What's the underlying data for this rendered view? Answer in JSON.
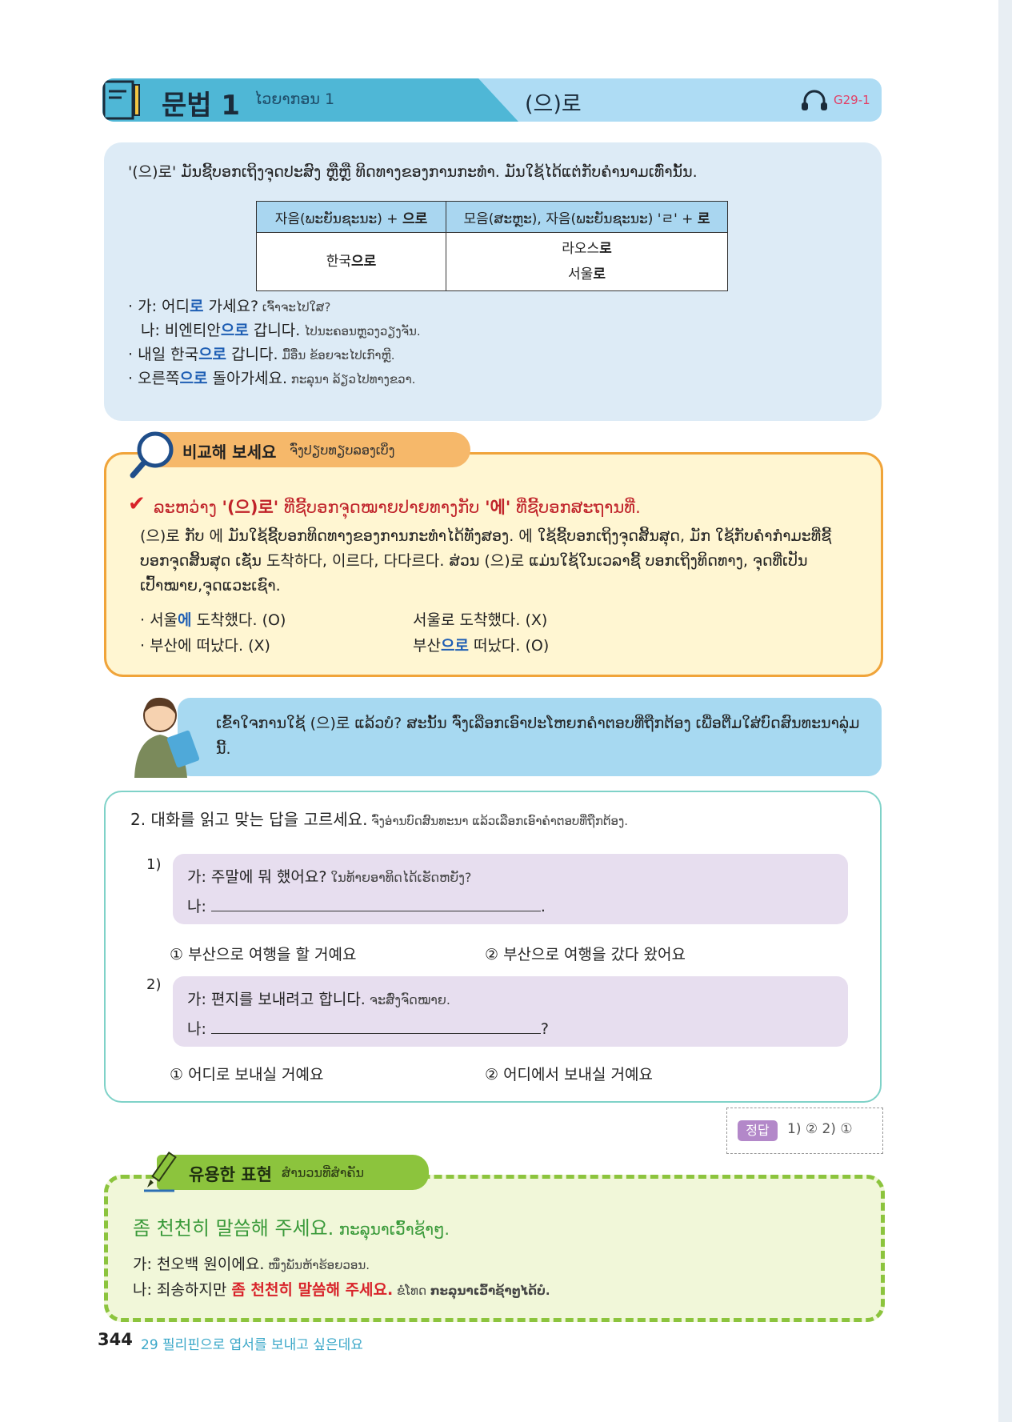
{
  "header": {
    "title": "문법 1",
    "lao": "ໄວຍາກອນ 1",
    "pattern": "(으)로",
    "audio_code": "G29-1"
  },
  "grammar": {
    "intro": "'(으)로' ມັນຊີ້ບອກເຖິງຈຸດປະສົງ ຫຼືຫຼື ທິດທາງຂອງການກະທຳ. ມັນໃຊ້ໄດ້ແຕ່ກັບຄຳນາມເທົ່ານັ້ນ.",
    "table": {
      "head_a": "자음(ພະຍັນຊະນະ) + ",
      "head_a_bold": "으로",
      "head_b": "모음(ສະຫຼະ), 자음(ພະຍັນຊະນະ) 'ㄹ' + ",
      "head_b_bold": "로",
      "cell_a_stem": "한국",
      "cell_a_ending": "으로",
      "cell_b1_stem": "라오스",
      "cell_b1_ending": "로",
      "cell_b2_stem": "서울",
      "cell_b2_ending": "로"
    },
    "examples": [
      {
        "bullet": "·",
        "pre": "가: 어디",
        "hl": "로",
        "post": " 가세요?",
        "lao": " ເຈົ້າຈະໄປໃສ?"
      },
      {
        "bullet": "",
        "pre": "나: 비엔티안",
        "hl": "으로",
        "post": " 갑니다.",
        "lao": " ໄປນະຄອນຫຼວງວຽງຈັນ."
      },
      {
        "bullet": "·",
        "pre": "내일 한국",
        "hl": "으로",
        "post": " 갑니다.",
        "lao": " ມື້ອື່ນ ຂ້ອຍຈະໄປເກົາຫຼີ."
      },
      {
        "bullet": "·",
        "pre": "오른쪽",
        "hl": "으로",
        "post": " 돌아가세요.",
        "lao": " ກະລຸນາ ລ້ຽວໄປທາງຂວາ."
      }
    ]
  },
  "compare": {
    "title": "비교해 보세요",
    "lao": "ຈົ່ງປຽບທຽບລອງເບິ່ງ",
    "heading_1": "ລະຫວ່າງ ",
    "heading_bold_1": "'(으)로'",
    "heading_2": " ທີ່ຊີ້ບອກຈຸດໝາຍປາຍທາງກັບ ",
    "heading_bold_2": "'에'",
    "heading_3": " ທີ່ຊີ້ບອກສະຖານທີ່.",
    "body": "(으)로 ກັບ 에 ມັນໃຊ້ຊີ້ບອກທິດທາງຂອງການກະທຳໄດ້ທັງສອງ. 에 ໃຊ້ຊີ້ບອກເຖິງຈຸດສິ້ນສຸດ, ມັກ ໃຊ້ກັບຄຳກຳມະທີ່ຊີ້ບອກຈຸດສິ້ນສຸດ ເຊັ່ນ 도착하다, 이르다, 다다르다. ສ່ວນ (으)로 ແມ່ນໃຊ້ໃນເວລາຊີ້ ບອກເຖິງທິດທາງ, ຈຸດທີ່ເປັນເປົ້າໝາຍ,ຈຸດແວະເຊົາ.",
    "examples": [
      {
        "pre": "· 서울",
        "hl": "에",
        "post": " 도착했다. (O)"
      },
      {
        "pre": "서울로 도착했다. (X)",
        "hl": "",
        "post": ""
      },
      {
        "pre": "· 부산에 떠났다. (X)",
        "hl": "",
        "post": ""
      },
      {
        "pre": "부산",
        "hl": "으로",
        "post": " 떠났다. (O)"
      }
    ]
  },
  "speech": "ເຂົ້າໃຈການໃຊ້ (으)로 ແລ້ວບໍ? ສະນັ້ນ ຈົ່ງເລືອກເອົາປະໂຫຍກຄຳຕອບທີ່ຖືກຕ້ອງ ເພື່ອຕື່ມໃສ່ບົດສົນທະນາລຸ່ມນີ້.",
  "exercise": {
    "title": "2. 대화를 읽고 맞는 답을 고르세요.",
    "lao": " ຈົ່ງອ່ານບົດສົນທະນາ ແລ້ວເລືອກເອົາຄຳຕອບທີ່ຖືກຕ້ອງ.",
    "questions": [
      {
        "num": "1)",
        "line_a": "가: 주말에 뭐 했어요?",
        "line_a_lao": " ໃນທ້າຍອາທິດໄດ້ເຮັດຫຍັງ?",
        "line_b_prefix": "나: ",
        "line_b_end": ".",
        "opt1": "① 부산으로 여행을 할 거예요",
        "opt2": "② 부산으로 여행을 갔다 왔어요"
      },
      {
        "num": "2)",
        "line_a": "가: 편지를 보내려고 합니다.",
        "line_a_lao": " ຈະສົ່ງຈົດໝາຍ.",
        "line_b_prefix": "나: ",
        "line_b_end": "?",
        "opt1": "① 어디로 보내실 거예요",
        "opt2": "② 어디에서 보내실 거예요"
      }
    ]
  },
  "answer": {
    "label": "정답",
    "text": "1) ②   2) ①"
  },
  "useful": {
    "title": "유용한 표현",
    "lao": "ສຳນວນທີ່ສຳຄັນ",
    "main": "좀 천천히 말씀해 주세요.",
    "main_lao": " ກະລຸນາເວົ້າຊ້າໆ.",
    "line1": "가: 천오백 원이에요.",
    "line1_lao": " ໜຶ່ງພັນຫ້າຮ້ອຍວອນ.",
    "line2_pre": "나: 죄송하지만 ",
    "line2_hl": "좀 천천히 말씀해 주세요.",
    "line2_lao": "  ຂໍໂທດ ",
    "line2_lao_hl": "ກະລຸນາເວົ້າຊ້າໆໄດ້ບໍ."
  },
  "footer": {
    "page": "344",
    "chapter": "29 필리핀으로 엽서를 보내고 싶은데요"
  },
  "colors": {
    "header_blue": "#4fb7d6",
    "header_light": "#aedcf4",
    "highlight_blue": "#1f5fb4",
    "red": "#d8232a",
    "compare_border": "#f0a43a",
    "useful_green": "#8cc43d",
    "footer_blue": "#3aa7c8"
  },
  "icons": [
    "book-icon",
    "headphone-icon",
    "magnifier-icon",
    "check-icon",
    "pencil-icon"
  ]
}
